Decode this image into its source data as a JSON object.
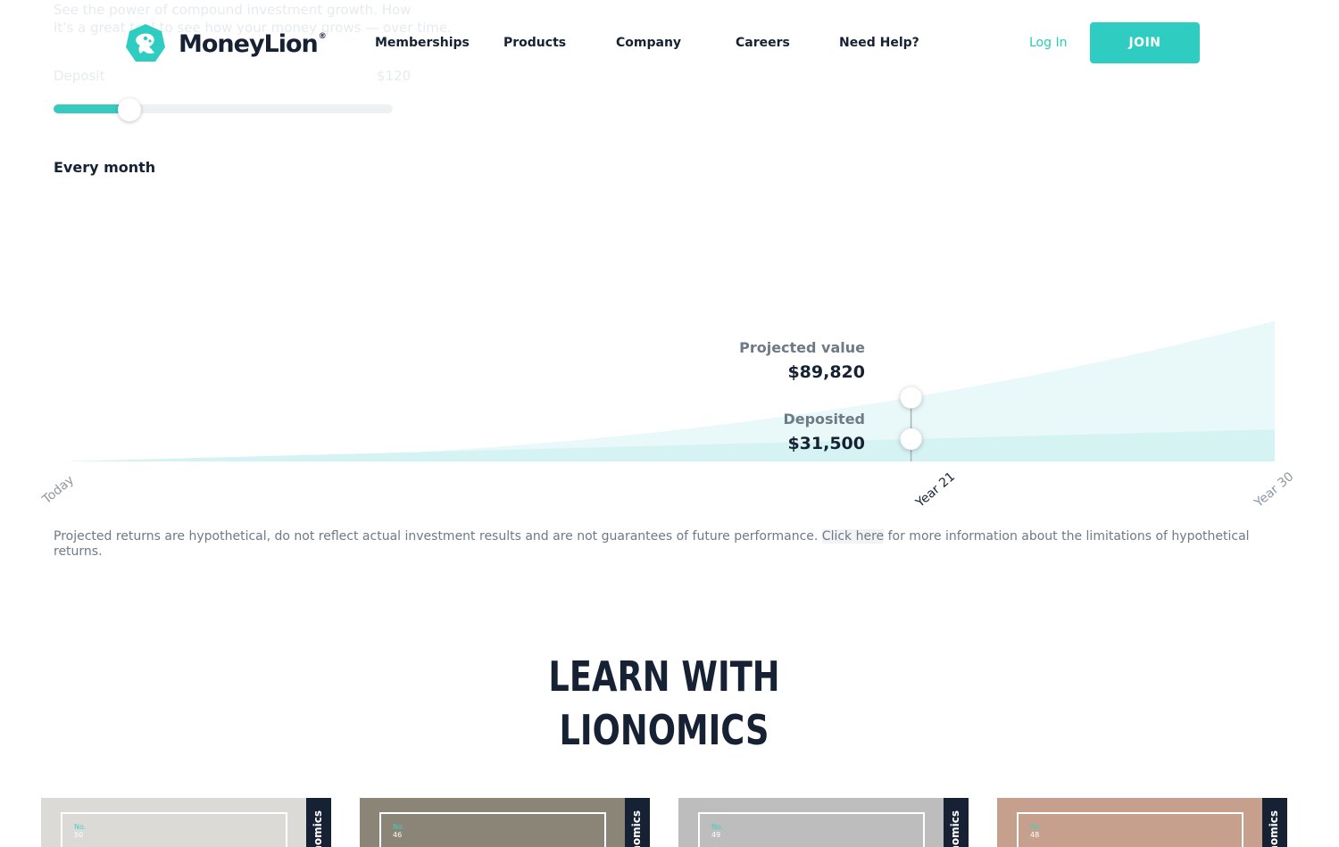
{
  "brand": {
    "name": "MoneyLion",
    "registered": "®",
    "accent": "#2fcdc1",
    "dark": "#162233"
  },
  "nav": {
    "items": [
      "Memberships",
      "Products",
      "Company",
      "Careers",
      "Need Help?"
    ],
    "login": "Log In",
    "join": "JOIN"
  },
  "ghost": {
    "line1": "See the power of compound investment growth. How",
    "line2": "It's a great tool to see how your money grows — over time.",
    "amount_label": "Deposit",
    "amount_value": "$120"
  },
  "slider": {
    "fraction": 0.224
  },
  "frequency": "Every month",
  "chart": {
    "projected_label": "Projected value",
    "projected_value": "$89,820",
    "deposited_label": "Deposited",
    "deposited_value": "$31,500",
    "ticks": [
      "Today",
      "Year 21",
      "Year 30"
    ],
    "selected_year": 21,
    "total_years": 30,
    "projected_color": "#e9f8f8",
    "deposited_color": "#d5f3f3"
  },
  "chart_data": {
    "type": "area",
    "x": [
      0,
      21,
      30
    ],
    "x_tick_labels": [
      "Today",
      "Year 21",
      "Year 30"
    ],
    "series": [
      {
        "name": "Projected value",
        "values": [
          0,
          89820,
          198000
        ]
      },
      {
        "name": "Deposited",
        "values": [
          0,
          31500,
          45000
        ]
      }
    ],
    "title": "",
    "xlabel": "",
    "ylabel": "",
    "grid": false,
    "legend": "none"
  },
  "disclaimer": {
    "before": "Projected returns are hypothetical, do not reflect actual investment results and are not guarantees of future performance. ",
    "link": "Click here",
    "after": " for more information about the limitations of hypothetical returns."
  },
  "learn": {
    "line1": "LEARN WITH",
    "line2": "LIONOMICS"
  },
  "cards": [
    {
      "no_label": "No.",
      "no_value": "50",
      "strip": "Lionomics",
      "bg": "#dcdad6"
    },
    {
      "no_label": "No.",
      "no_value": "46",
      "strip": "Lionomics",
      "bg": "#8a8576"
    },
    {
      "no_label": "No.",
      "no_value": "49",
      "strip": "Lionomics",
      "bg": "#bdbdbd"
    },
    {
      "no_label": "No.",
      "no_value": "48",
      "strip": "Lionomics",
      "bg": "#c7a08d"
    }
  ]
}
